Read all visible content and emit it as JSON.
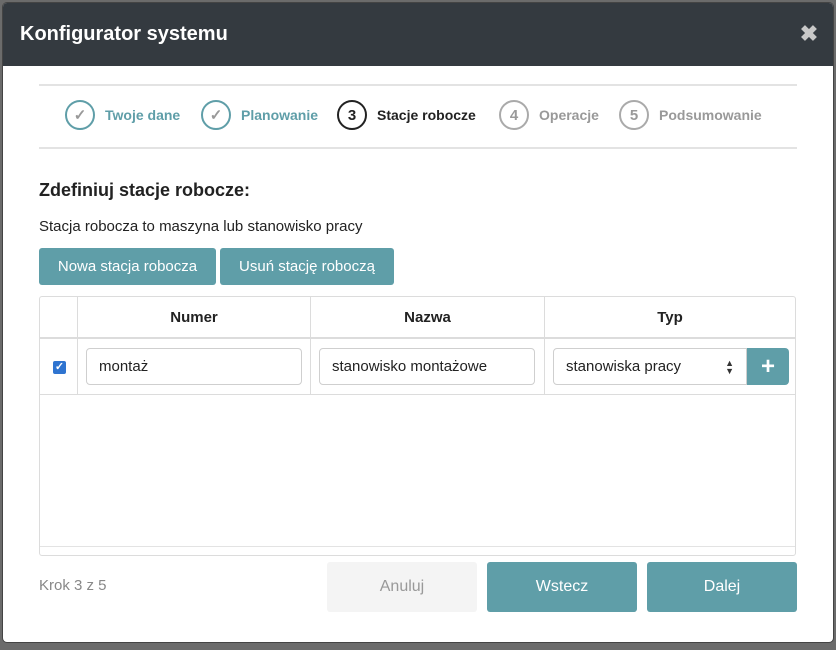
{
  "modal": {
    "title": "Konfigurator systemu",
    "close_symbol": "✖"
  },
  "stepper": {
    "steps": [
      {
        "marker": "✓",
        "label": "Twoje dane",
        "state": "done"
      },
      {
        "marker": "✓",
        "label": "Planowanie",
        "state": "done"
      },
      {
        "marker": "3",
        "label": "Stacje robocze",
        "state": "active"
      },
      {
        "marker": "4",
        "label": "Operacje",
        "state": "todo"
      },
      {
        "marker": "5",
        "label": "Podsumowanie",
        "state": "todo"
      }
    ]
  },
  "section": {
    "title": "Zdefiniuj stacje robocze:",
    "description": "Stacja robocza to maszyna lub stanowisko pracy"
  },
  "toolbar": {
    "new_label": "Nowa stacja robocza",
    "delete_label": "Usuń stację roboczą"
  },
  "table": {
    "columns": [
      "Numer",
      "Nazwa",
      "Typ"
    ],
    "rows": [
      {
        "checked": true,
        "number": "montaż",
        "name": "stanowisko montażowe",
        "type": "stanowiska pracy"
      }
    ],
    "add_symbol": "+"
  },
  "footer": {
    "step_text": "Krok 3 z 5",
    "cancel_label": "Anuluj",
    "back_label": "Wstecz",
    "next_label": "Dalej"
  },
  "colors": {
    "header_bg": "#343a40",
    "accent": "#5f9ea8",
    "checkbox": "#2f74d0"
  }
}
